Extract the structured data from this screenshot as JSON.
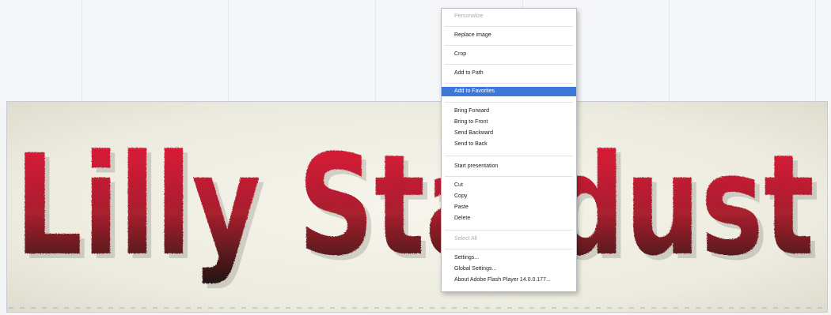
{
  "banner": {
    "title": "Lilly Stardust",
    "gradient_top": "#e8173a",
    "gradient_bottom": "#1c1410"
  },
  "context_menu": {
    "items": [
      {
        "label": "Personalize",
        "disabled": true
      },
      {
        "label": "Replace image"
      },
      {
        "label": "Crop"
      },
      {
        "label": "Add to Path"
      },
      {
        "label": "Add to Favorites",
        "highlighted": true
      },
      {
        "label": "Bring Forward"
      },
      {
        "label": "Bring to Front"
      },
      {
        "label": "Send Backward"
      },
      {
        "label": "Send to Back"
      },
      {
        "label": "Start presentation"
      },
      {
        "label": "Cut"
      },
      {
        "label": "Copy"
      },
      {
        "label": "Paste"
      },
      {
        "label": "Delete"
      },
      {
        "label": "Select All",
        "disabled": true
      },
      {
        "label": "Settings..."
      },
      {
        "label": "Global Settings..."
      },
      {
        "label": "About Adobe Flash Player 14.0.0.177..."
      }
    ]
  },
  "colors": {
    "highlight": "#3b78d8",
    "menu_bg": "#ffffff",
    "canvas_bg": "#f4f5f7"
  }
}
